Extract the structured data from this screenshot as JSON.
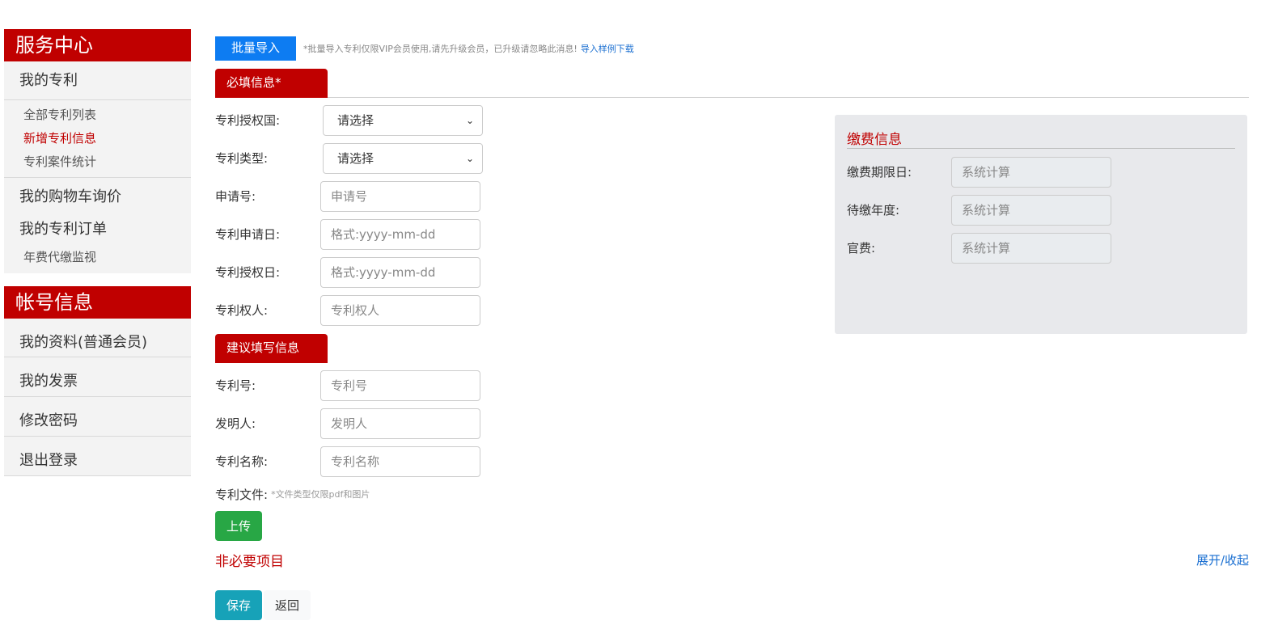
{
  "sidebar": {
    "service_center": "服务中心",
    "my_patents": "我的专利",
    "sub_items": [
      "全部专利列表",
      "新增专利信息",
      "专利案件统计"
    ],
    "cart_inquiry": "我的购物车询价",
    "patent_orders": "我的专利订单",
    "annual_fee_monitor": "年费代缴监视",
    "account_info": "帐号信息",
    "my_profile": "我的资料(普通会员)",
    "my_invoice": "我的发票",
    "change_password": "修改密码",
    "logout": "退出登录"
  },
  "toolbar": {
    "batch_import": "批量导入",
    "hint": "*批量导入专利仅限VIP会员使用,请先升级会员，已升级请忽略此消息!",
    "sample_link": "导入样例下载"
  },
  "required_section": {
    "tab": "必填信息*",
    "fields": {
      "country_label": "专利授权国:",
      "country_value": "请选择",
      "type_label": "专利类型:",
      "type_value": "请选择",
      "app_no_label": "申请号:",
      "app_no_placeholder": "申请号",
      "app_date_label": "专利申请日:",
      "app_date_placeholder": "格式:yyyy-mm-dd",
      "grant_date_label": "专利授权日:",
      "grant_date_placeholder": "格式:yyyy-mm-dd",
      "holder_label": "专利权人:",
      "holder_placeholder": "专利权人"
    }
  },
  "suggested_section": {
    "tab": "建议填写信息",
    "fields": {
      "patent_no_label": "专利号:",
      "patent_no_placeholder": "专利号",
      "inventor_label": "发明人:",
      "inventor_placeholder": "发明人",
      "name_label": "专利名称:",
      "name_placeholder": "专利名称",
      "file_label": "专利文件:",
      "file_hint": "*文件类型仅限pdf和图片",
      "upload_button": "上传"
    }
  },
  "optional": {
    "label": "非必要项目",
    "toggle": "展开/收起"
  },
  "actions": {
    "save": "保存",
    "back": "返回"
  },
  "fee_panel": {
    "title": "缴费信息",
    "rows": [
      {
        "label": "缴费期限日:",
        "value": "系统计算"
      },
      {
        "label": "待缴年度:",
        "value": "系统计算"
      },
      {
        "label": "官费:",
        "value": "系统计算"
      }
    ]
  },
  "colors": {
    "brand_red": "#c00000",
    "primary_blue": "#0d7cf2",
    "upload_green": "#28a745",
    "save_teal": "#17a2b8"
  }
}
